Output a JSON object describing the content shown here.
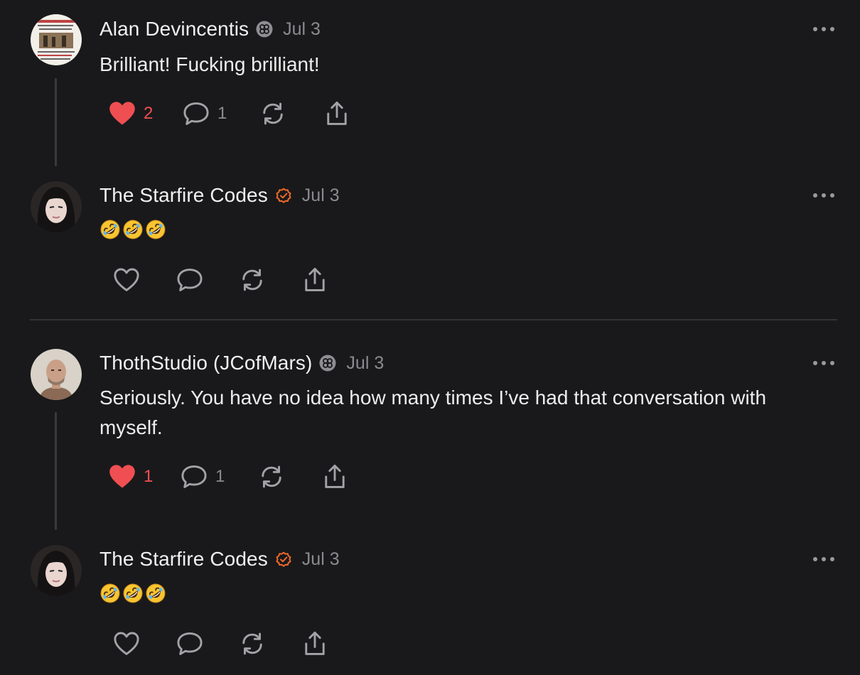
{
  "colors": {
    "background": "#19191b",
    "heart_red": "#ef4f52",
    "verified_orange": "#f06a2a",
    "muted": "#8b8b8f"
  },
  "comments": [
    {
      "author": "Alan Devincentis",
      "badge_icon": "subscriber-badge-icon",
      "date": "Jul 3",
      "text": "Brilliant! Fucking brilliant!",
      "likes": "2",
      "replies": "1",
      "liked": true
    },
    {
      "author": "The Starfire Codes",
      "badge_icon": "verified-badge-icon",
      "date": "Jul 3",
      "text": "🤣🤣🤣",
      "likes": "",
      "replies": "",
      "liked": false
    },
    {
      "author": "ThothStudio (JCofMars)",
      "badge_icon": "subscriber-badge-icon",
      "date": "Jul 3",
      "text_line1": "Seriously. You have no idea how many times I’ve had that conversation with",
      "text_line2": "myself.",
      "likes": "1",
      "replies": "1",
      "liked": true
    },
    {
      "author": "The Starfire Codes",
      "badge_icon": "verified-badge-icon",
      "date": "Jul 3",
      "text": "🤣🤣🤣",
      "likes": "",
      "replies": "",
      "liked": false
    }
  ]
}
